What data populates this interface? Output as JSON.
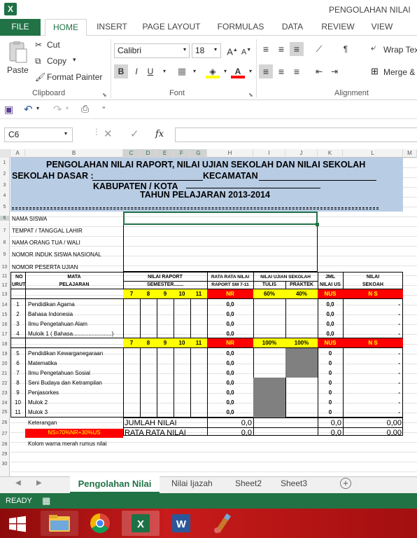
{
  "window": {
    "title": "PENGOLAHAN NILAI",
    "app_icon": "X"
  },
  "ribbon_tabs": [
    "FILE",
    "HOME",
    "INSERT",
    "PAGE LAYOUT",
    "FORMULAS",
    "DATA",
    "REVIEW",
    "VIEW"
  ],
  "clipboard": {
    "paste": "Paste",
    "cut": "Cut",
    "copy": "Copy",
    "format_painter": "Format Painter",
    "label": "Clipboard"
  },
  "font": {
    "name": "Calibri",
    "size": "18",
    "bold": "B",
    "italic": "I",
    "underline": "U",
    "label": "Font"
  },
  "alignment": {
    "wrap_text": "Wrap Text",
    "merge": "Merge &",
    "label": "Alignment"
  },
  "formula_bar": {
    "cell_ref": "C6",
    "fx": "fx",
    "value": ""
  },
  "columns": [
    "A",
    "B",
    "C",
    "D",
    "E",
    "F",
    "G",
    "H",
    "I",
    "J",
    "K",
    "L",
    "M"
  ],
  "rows": [
    "1",
    "2",
    "3",
    "4",
    "5",
    "6",
    "7",
    "8",
    "9",
    "10",
    "11",
    "12",
    "13",
    "14",
    "15",
    "16",
    "17",
    "18",
    "19",
    "20",
    "21",
    "22",
    "23",
    "24",
    "25",
    "26",
    "27",
    "28",
    "29",
    "30"
  ],
  "header": {
    "line1": "PENGOLAHAN  NILAI RAPORT, NILAI UJIAN SEKOLAH DAN NILAI SEKOLAH",
    "line2_a": "SEKOLAH  DASAR :",
    "line2_b": "KECAMATAN",
    "line3": "KABUPATEN / KOTA",
    "line4": "TAHUN  PELAJARAN  2013-2014"
  },
  "student_fields": [
    "NAMA  SISWA",
    "TEMPAT / TANGGAL LAHIR",
    "NAMA ORANG TUA / WALI",
    "NOMOR INDUK SISWA NASIONAL",
    "NOMOR PESERTA UJIAN"
  ],
  "table_header": {
    "no1": "NO",
    "no2": "URUT",
    "mata1": "MATA",
    "mata2": "PELAJARAN",
    "nilai_raport": "NILAI    RAPORT",
    "semester": "SEMESTER.......",
    "rata1": "RATA RATA NILAI",
    "rata2": "RAPORT SM 7-11",
    "ujian": "NILAI UJIAN SEKOLAH",
    "tulis": "TULIS",
    "praktek": "PRAKTEK",
    "jml1": "JML",
    "jml2": "NILAI US",
    "ns1": "NILAI",
    "ns2": "SEKOAH"
  },
  "yellow_row_1": {
    "semesters": [
      "7",
      "8",
      "9",
      "10",
      "11"
    ],
    "nr": "NR",
    "tulis": "60%",
    "praktek": "40%",
    "nus": "NUS",
    "ns": "N  S"
  },
  "yellow_row_2": {
    "semesters": [
      "7",
      "8",
      "9",
      "10",
      "11"
    ],
    "nr": "NR",
    "tulis": "100%",
    "praktek": "100%",
    "nus": "NUS",
    "ns": "N  S"
  },
  "group1": [
    {
      "no": "1",
      "name": "Pendidikan Agama",
      "rata": "0,0",
      "jml": "0,0",
      "ns": "-"
    },
    {
      "no": "2",
      "name": "Bahasa Indonesia",
      "rata": "0,0",
      "jml": "0,0",
      "ns": "-"
    },
    {
      "no": "3",
      "name": "Ilmu Pengetahuan Alam",
      "rata": "0,0",
      "jml": "0,0",
      "ns": "-"
    },
    {
      "no": "4",
      "name": "Muloik 1  ( Bahasa.........................)",
      "rata": "0,0",
      "jml": "0,0",
      "ns": "-"
    }
  ],
  "group2": [
    {
      "no": "5",
      "name": "Pendidikan Kewarganegaraan",
      "rata": "0,0",
      "jml": "0",
      "ns": "-"
    },
    {
      "no": "6",
      "name": "Matematika",
      "rata": "0,0",
      "jml": "0",
      "ns": "-"
    },
    {
      "no": "7",
      "name": "Ilmu Pengetahuan Sosial",
      "rata": "0,0",
      "jml": "0",
      "ns": "-"
    },
    {
      "no": "8",
      "name": "Seni Budaya dan Ketrampilan",
      "rata": "0,0",
      "jml": "0",
      "ns": "-"
    },
    {
      "no": "9",
      "name": "Penjasorkes",
      "rata": "0,0",
      "jml": "0",
      "ns": "-"
    },
    {
      "no": "10",
      "name": "Mulok 2",
      "rata": "0,0",
      "jml": "0",
      "ns": "-"
    },
    {
      "no": "11",
      "name": "Mulok 3",
      "rata": "0,0",
      "jml": "0",
      "ns": "-"
    }
  ],
  "footer": {
    "keterangan": "Keterangan",
    "jumlah": "JUMLAH NILAI",
    "jumlah_val": "0,0",
    "jumlah_jml": "0,0",
    "jumlah_ns": "0,00",
    "formula": "NS=70%NR+30%US",
    "rata": "RATA RATA NILAI",
    "rata_val": "0,0",
    "rata_jml": "0,0",
    "rata_ns": "0,00",
    "note": "Kolom warna merah rumus nilai"
  },
  "sheet_tabs": [
    "Pengolahan Nilai",
    "Nilai Ijazah",
    "Sheet2",
    "Sheet3"
  ],
  "status": "READY",
  "colors": {
    "excel_green": "#217346",
    "header_blue": "#b8cce4",
    "yellow": "#ffff00",
    "red": "#ff0000",
    "gray": "#808080"
  }
}
